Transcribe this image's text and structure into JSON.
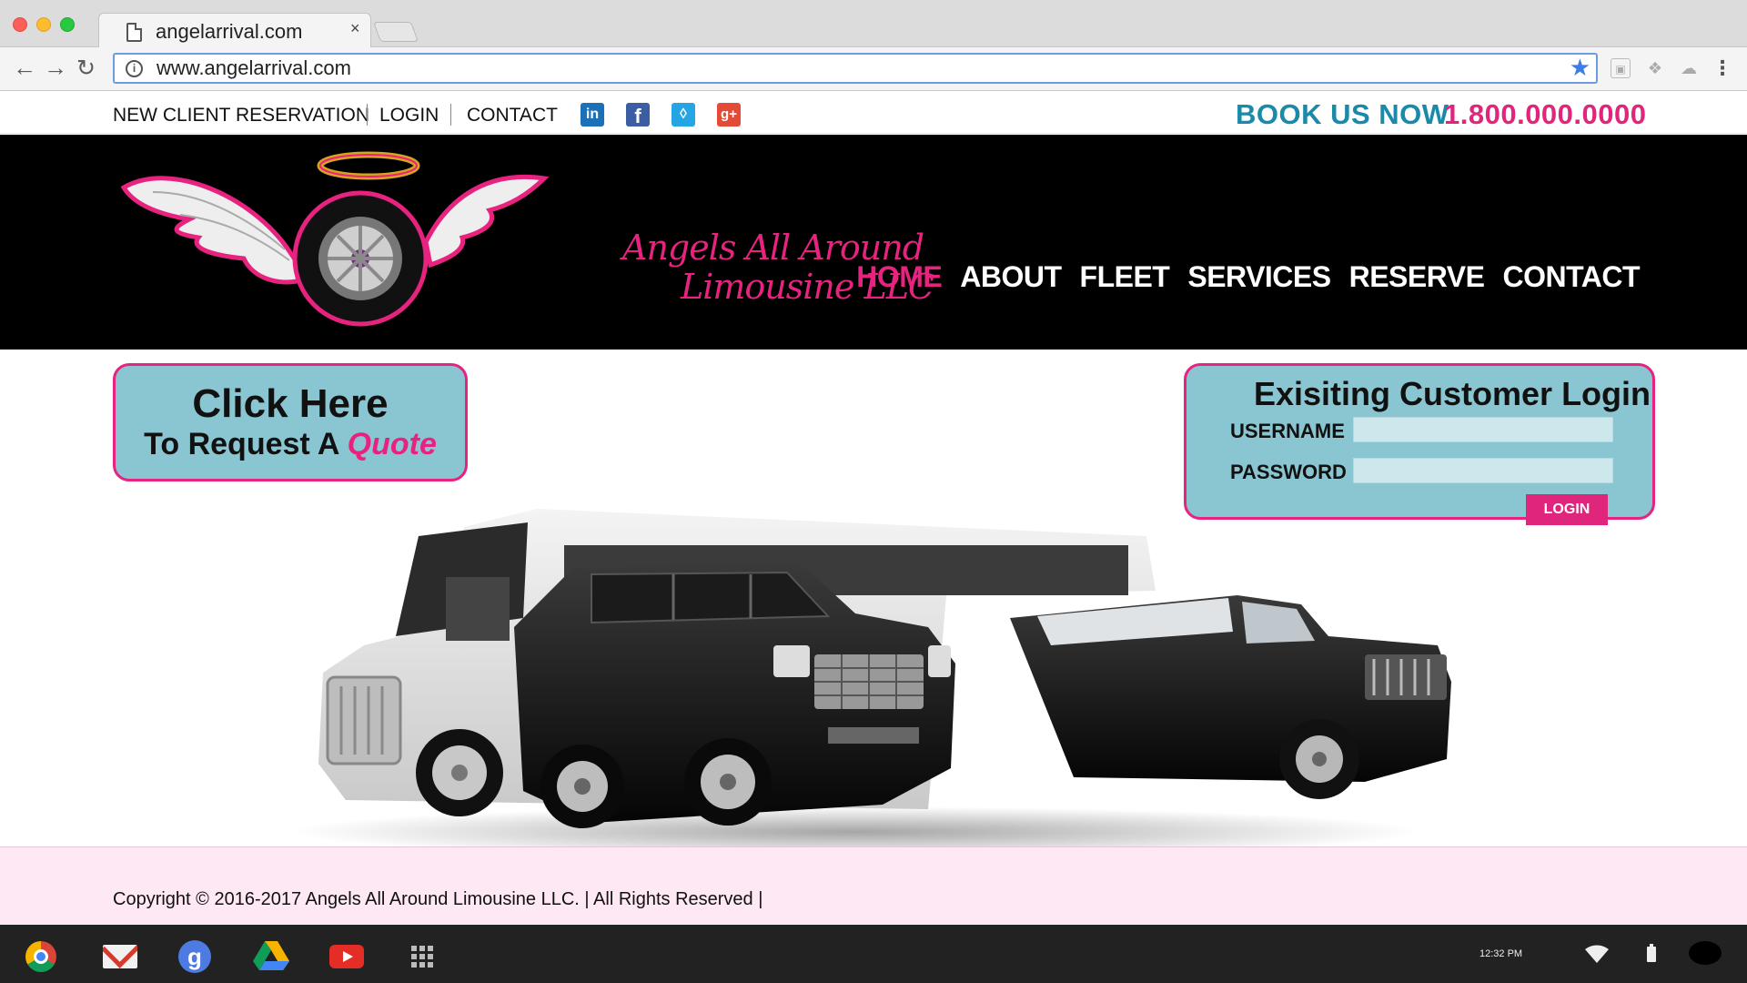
{
  "browser": {
    "tab_title": "angelarrival.com",
    "tab_close": "×",
    "url": "www.angelarrival.com"
  },
  "topbar": {
    "links": [
      "NEW CLIENT RESERVATION",
      "LOGIN",
      "CONTACT"
    ],
    "book_label": "BOOK US NOW",
    "phone": "1.800.000.0000"
  },
  "header": {
    "logo_line1": "Angels All Around",
    "logo_line2": "Limousine LLC",
    "nav": [
      "HOME",
      "ABOUT",
      "FLEET",
      "SERVICES",
      "RESERVE",
      "CONTACT"
    ],
    "active_nav": "HOME"
  },
  "quote": {
    "title": "Click Here",
    "subtitle_prefix": "To Request A ",
    "subtitle_highlight": "Quote"
  },
  "login": {
    "title": "Exisiting Customer Login",
    "username_label": "USERNAME",
    "password_label": "PASSWORD",
    "button": "LOGIN"
  },
  "footer": {
    "copyright": "Copyright © 2016-2017 Angels All Around Limousine LLC. | All Rights Reserved |"
  },
  "taskbar": {
    "time": "12:32 PM"
  },
  "colors": {
    "brand_pink": "#e8237f",
    "brand_teal": "#1a8aa8",
    "box_teal": "#89c6d1",
    "footer_pink": "#fde8f3"
  }
}
